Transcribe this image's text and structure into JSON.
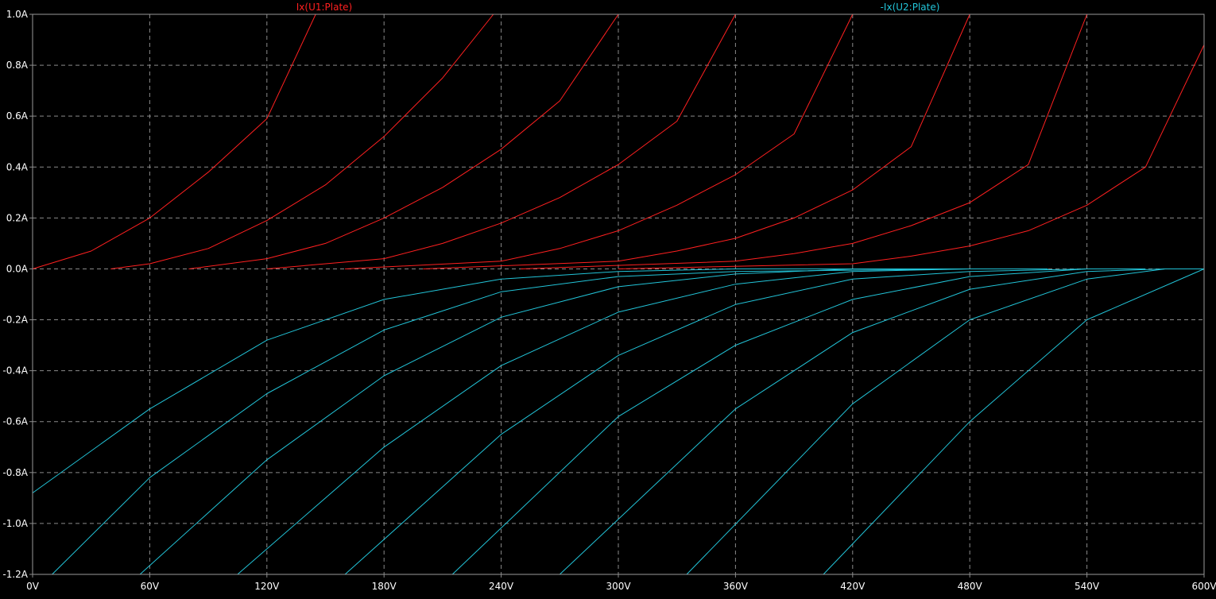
{
  "chart_data": {
    "type": "line",
    "x_unit": "V",
    "y_unit": "A",
    "xlim": [
      0,
      600
    ],
    "ylim": [
      -1.2,
      1.0
    ],
    "grid": true,
    "background_color": "#000000",
    "grid_color": "#8a8a8a",
    "axis_text_color": "#ffffff",
    "x_ticks": [
      "0V",
      "60V",
      "120V",
      "180V",
      "240V",
      "300V",
      "360V",
      "420V",
      "480V",
      "540V",
      "600V"
    ],
    "x_tick_values": [
      0,
      60,
      120,
      180,
      240,
      300,
      360,
      420,
      480,
      540,
      600
    ],
    "y_ticks": [
      "1.0A",
      "0.8A",
      "0.6A",
      "0.4A",
      "0.2A",
      "0.0A",
      "-0.2A",
      "-0.4A",
      "-0.6A",
      "-0.8A",
      "-1.0A",
      "-1.2A"
    ],
    "y_tick_values": [
      1.0,
      0.8,
      0.6,
      0.4,
      0.2,
      0.0,
      -0.2,
      -0.4,
      -0.6,
      -0.8,
      -1.0,
      -1.2
    ],
    "series": [
      {
        "name": "Ix(U1:Plate)",
        "color": "#ff2020",
        "curves": [
          {
            "x": [
              0,
              30,
              60,
              90,
              120,
              145
            ],
            "y": [
              0.0,
              0.07,
              0.2,
              0.38,
              0.59,
              1.0
            ]
          },
          {
            "x": [
              40,
              60,
              90,
              120,
              150,
              180,
              210,
              236
            ],
            "y": [
              0.0,
              0.02,
              0.08,
              0.19,
              0.33,
              0.52,
              0.75,
              1.0
            ]
          },
          {
            "x": [
              80,
              120,
              150,
              180,
              210,
              240,
              270,
              300
            ],
            "y": [
              0.0,
              0.04,
              0.1,
              0.2,
              0.32,
              0.47,
              0.66,
              1.0
            ]
          },
          {
            "x": [
              120,
              180,
              210,
              240,
              270,
              300,
              330,
              360
            ],
            "y": [
              0.0,
              0.04,
              0.1,
              0.18,
              0.28,
              0.41,
              0.58,
              1.0
            ]
          },
          {
            "x": [
              160,
              240,
              270,
              300,
              330,
              360,
              390,
              420
            ],
            "y": [
              0.0,
              0.03,
              0.08,
              0.15,
              0.25,
              0.37,
              0.53,
              1.0
            ]
          },
          {
            "x": [
              200,
              300,
              330,
              360,
              390,
              420,
              450,
              480
            ],
            "y": [
              0.0,
              0.03,
              0.07,
              0.12,
              0.2,
              0.31,
              0.48,
              1.0
            ]
          },
          {
            "x": [
              250,
              360,
              390,
              420,
              450,
              480,
              510,
              540
            ],
            "y": [
              0.0,
              0.03,
              0.06,
              0.1,
              0.17,
              0.26,
              0.41,
              1.0
            ]
          },
          {
            "x": [
              300,
              420,
              450,
              480,
              510,
              540,
              570,
              600
            ],
            "y": [
              0.0,
              0.02,
              0.05,
              0.09,
              0.15,
              0.25,
              0.4,
              0.88
            ]
          }
        ]
      },
      {
        "name": "-Ix(U2:Plate)",
        "color": "#22c4d8",
        "curves": [
          {
            "x": [
              0,
              60,
              120,
              180,
              240,
              300,
              360,
              450
            ],
            "y": [
              -0.88,
              -0.55,
              -0.28,
              -0.12,
              -0.04,
              -0.01,
              0.0,
              0.0
            ]
          },
          {
            "x": [
              10,
              60,
              120,
              180,
              240,
              300,
              360,
              480
            ],
            "y": [
              -1.2,
              -0.82,
              -0.49,
              -0.24,
              -0.09,
              -0.03,
              -0.01,
              0.0
            ]
          },
          {
            "x": [
              55,
              120,
              180,
              240,
              300,
              360,
              420,
              500
            ],
            "y": [
              -1.2,
              -0.75,
              -0.42,
              -0.19,
              -0.07,
              -0.02,
              0.0,
              0.0
            ]
          },
          {
            "x": [
              105,
              180,
              240,
              300,
              360,
              420,
              480,
              520
            ],
            "y": [
              -1.2,
              -0.7,
              -0.38,
              -0.17,
              -0.06,
              -0.01,
              0.0,
              0.0
            ]
          },
          {
            "x": [
              160,
              240,
              300,
              360,
              420,
              480,
              540
            ],
            "y": [
              -1.2,
              -0.65,
              -0.34,
              -0.14,
              -0.04,
              -0.01,
              0.0
            ]
          },
          {
            "x": [
              215,
              300,
              360,
              420,
              480,
              540,
              570
            ],
            "y": [
              -1.2,
              -0.58,
              -0.3,
              -0.12,
              -0.03,
              0.0,
              0.0
            ]
          },
          {
            "x": [
              270,
              360,
              420,
              480,
              540,
              580
            ],
            "y": [
              -1.2,
              -0.55,
              -0.25,
              -0.08,
              -0.01,
              0.0
            ]
          },
          {
            "x": [
              335,
              420,
              480,
              540,
              580,
              600
            ],
            "y": [
              -1.2,
              -0.53,
              -0.2,
              -0.04,
              0.0,
              0.0
            ]
          },
          {
            "x": [
              405,
              480,
              540,
              600
            ],
            "y": [
              -1.2,
              -0.6,
              -0.2,
              0.0
            ]
          }
        ]
      }
    ]
  }
}
